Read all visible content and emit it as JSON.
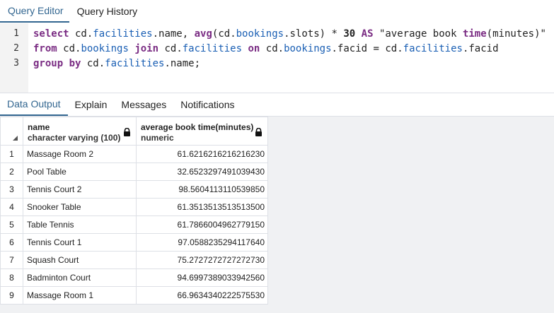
{
  "top_tabs": [
    "Query Editor",
    "Query History"
  ],
  "editor": {
    "line_numbers": [
      "1",
      "2",
      "3"
    ],
    "line1": {
      "k1": "select",
      "t1": " cd.",
      "f1": "facilities",
      "t2": ".name, ",
      "k2": "avg",
      "t3": "(cd.",
      "f2": "bookings",
      "t4": ".slots) * ",
      "n1": "30",
      "t5": " ",
      "k3": "AS",
      "t6": " \"average book ",
      "k4": "time",
      "t7": "(minutes)\""
    },
    "line2": {
      "k1": "from",
      "t1": " cd.",
      "f1": "bookings",
      "t2": " ",
      "k2": "join",
      "t3": " cd.",
      "f2": "facilities",
      "t4": " ",
      "k3": "on",
      "t5": " cd.",
      "f3": "bookings",
      "t6": ".facid = cd.",
      "f4": "facilities",
      "t7": ".facid"
    },
    "line3": {
      "k1": "group by",
      "t1": " cd.",
      "f1": "facilities",
      "t2": ".name;"
    }
  },
  "bottom_tabs": [
    "Data Output",
    "Explain",
    "Messages",
    "Notifications"
  ],
  "grid": {
    "columns": [
      {
        "name": "name",
        "type": "character varying (100)"
      },
      {
        "name": "average book time(minutes)",
        "type": "numeric"
      }
    ],
    "rows": [
      {
        "n": "1",
        "name": "Massage Room 2",
        "avg": "61.6216216216216230"
      },
      {
        "n": "2",
        "name": "Pool Table",
        "avg": "32.6523297491039430"
      },
      {
        "n": "3",
        "name": "Tennis Court 2",
        "avg": "98.5604113110539850"
      },
      {
        "n": "4",
        "name": "Snooker Table",
        "avg": "61.3513513513513500"
      },
      {
        "n": "5",
        "name": "Table Tennis",
        "avg": "61.7866004962779150"
      },
      {
        "n": "6",
        "name": "Tennis Court 1",
        "avg": "97.0588235294117640"
      },
      {
        "n": "7",
        "name": "Squash Court",
        "avg": "75.2727272727272730"
      },
      {
        "n": "8",
        "name": "Badminton Court",
        "avg": "94.6997389033942560"
      },
      {
        "n": "9",
        "name": "Massage Room 1",
        "avg": "66.9634340222575530"
      }
    ]
  },
  "colors": {
    "accent": "#326690",
    "keyword": "#7a2c83",
    "identifier": "#1a5fb4"
  }
}
